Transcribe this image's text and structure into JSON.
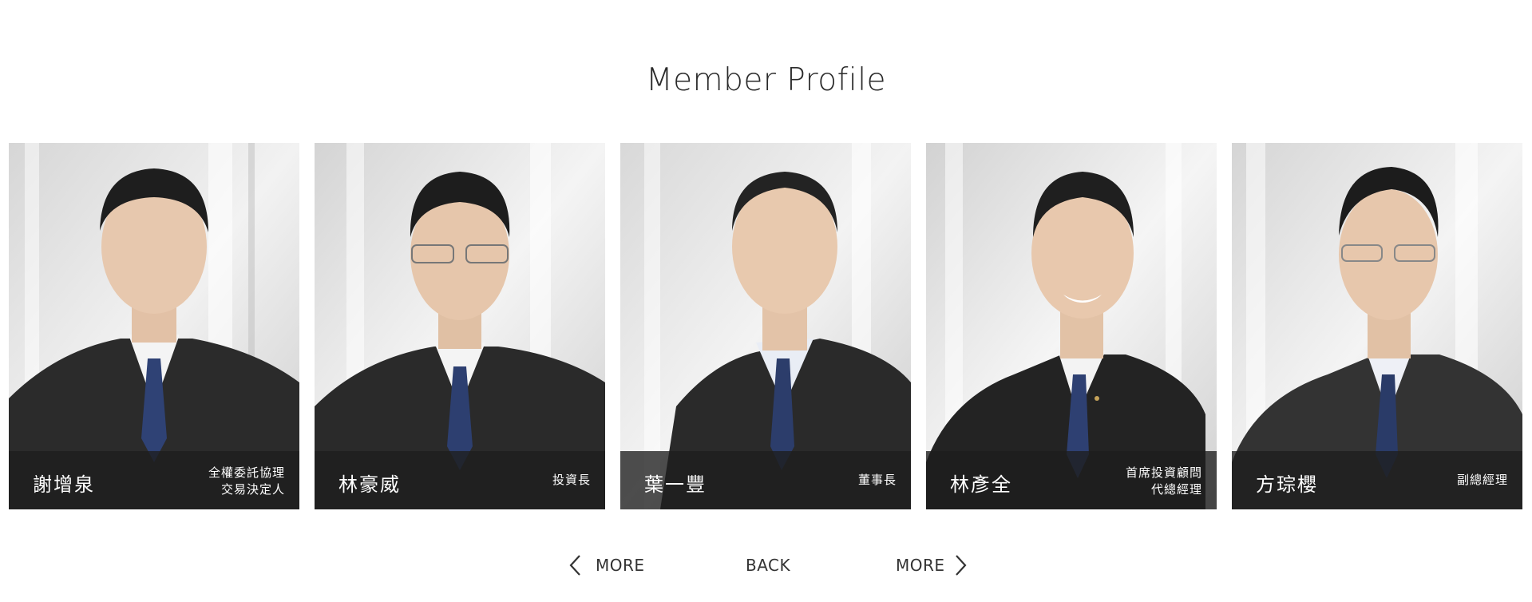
{
  "page": {
    "title": "Member Profile"
  },
  "members": [
    {
      "name": "謝增泉",
      "title_lines": [
        "全權委託協理",
        "交易決定人"
      ]
    },
    {
      "name": "林豪威",
      "title_lines": [
        "投資長"
      ]
    },
    {
      "name": "葉一豐",
      "title_lines": [
        "董事長"
      ]
    },
    {
      "name": "林彥全",
      "title_lines": [
        "首席投資顧問",
        "代總經理"
      ]
    },
    {
      "name": "方琮櫻",
      "title_lines": [
        "副總經理"
      ]
    }
  ],
  "navigation": {
    "prev_label": "MORE",
    "back_label": "BACK",
    "next_label": "MORE",
    "prev_icon": "chevron-left-icon",
    "next_icon": "chevron-right-icon"
  },
  "colors": {
    "caption_bar": "#1e1e1e",
    "suit": "#2a2a2a",
    "tie": "#2c3d6b",
    "background_photo": "#e6e6e6"
  }
}
